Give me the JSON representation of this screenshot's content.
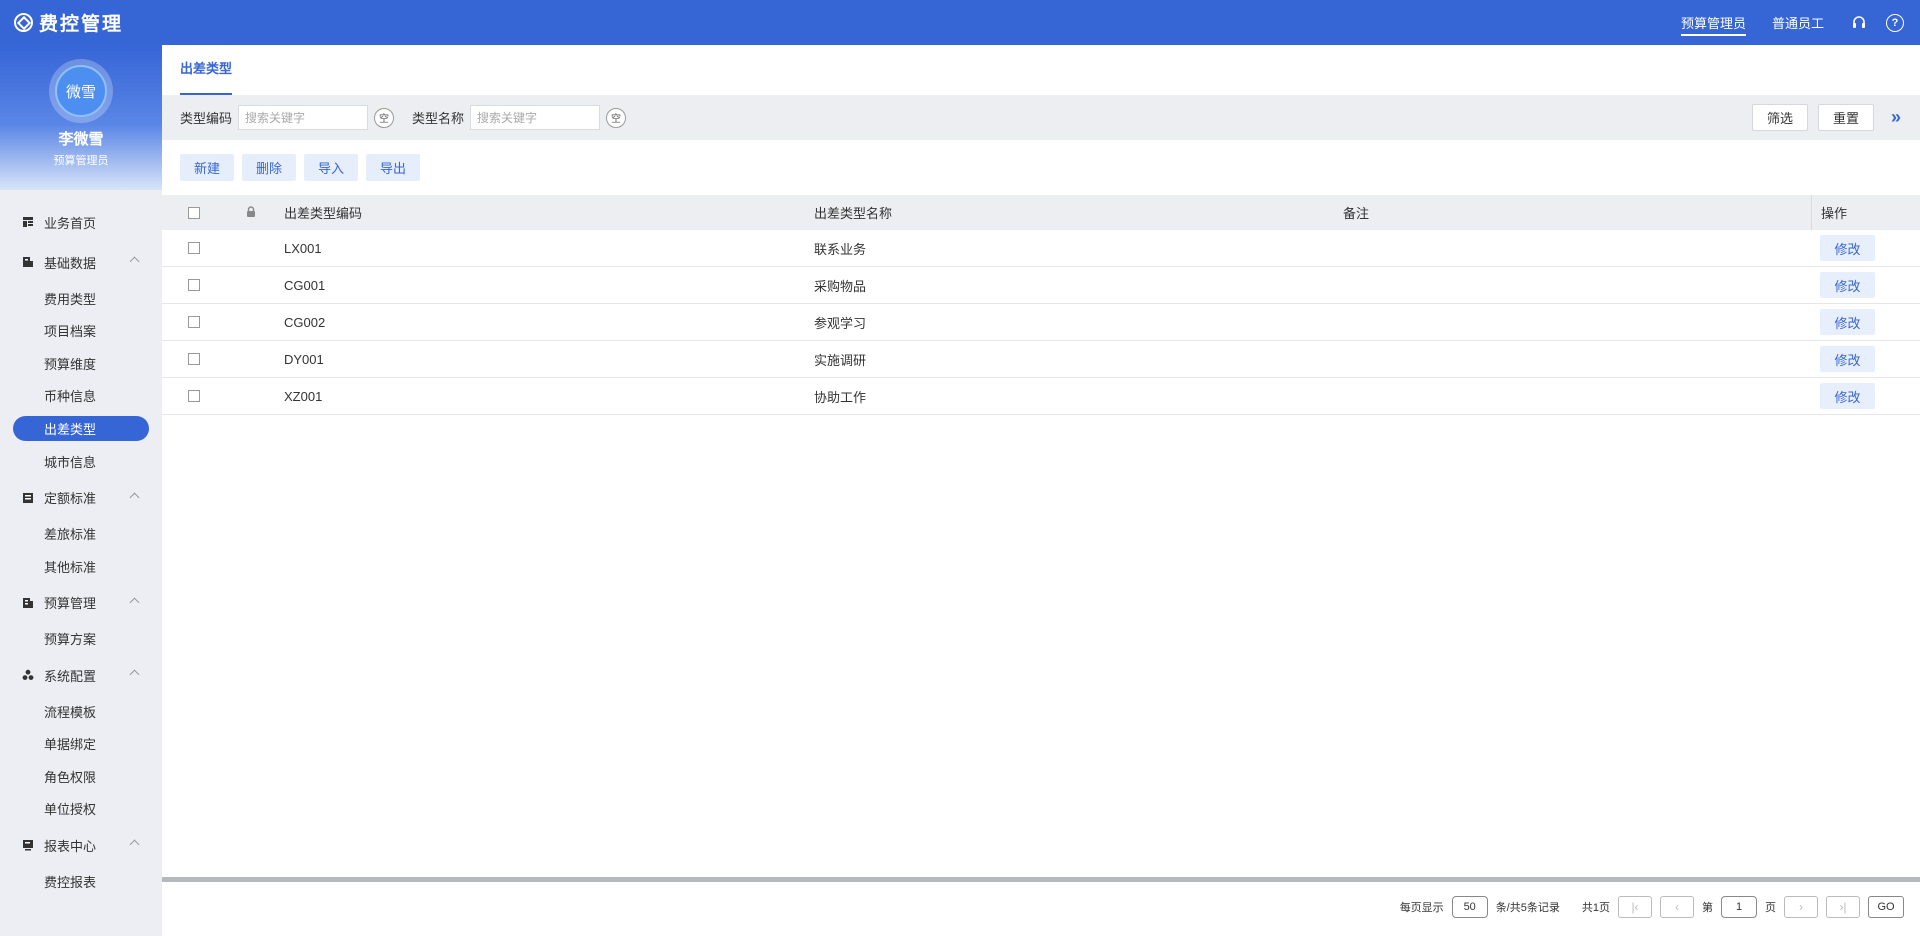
{
  "app": {
    "title": "费控管理"
  },
  "header": {
    "roles": [
      {
        "label": "预算管理员",
        "active": true
      },
      {
        "label": "普通员工",
        "active": false
      }
    ],
    "help_glyph": "?"
  },
  "profile": {
    "avatar_text": "微雪",
    "name": "李微雪",
    "role": "预算管理员"
  },
  "sidebar": {
    "home": "业务首页",
    "groups": [
      {
        "label": "基础数据",
        "icon": "database-icon",
        "items": [
          "费用类型",
          "项目档案",
          "预算维度",
          "币种信息",
          "出差类型",
          "城市信息"
        ]
      },
      {
        "label": "定额标准",
        "icon": "ledger-icon",
        "items": [
          "差旅标准",
          "其他标准"
        ]
      },
      {
        "label": "预算管理",
        "icon": "budget-icon",
        "items": [
          "预算方案"
        ]
      },
      {
        "label": "系统配置",
        "icon": "cluster-icon",
        "items": [
          "流程模板",
          "单据绑定",
          "角色权限",
          "单位授权"
        ]
      },
      {
        "label": "报表中心",
        "icon": "report-icon",
        "items": [
          "费控报表"
        ]
      }
    ],
    "active_item": "出差类型"
  },
  "page": {
    "tab": "出差类型"
  },
  "filters": {
    "code_label": "类型编码",
    "code_placeholder": "搜索关键字",
    "name_label": "类型名称",
    "name_placeholder": "搜索关键字",
    "clear_label": "空",
    "filter_button": "筛选",
    "reset_button": "重置",
    "expand_glyph": "»"
  },
  "toolbar": {
    "new": "新建",
    "delete": "删除",
    "import": "导入",
    "export": "导出"
  },
  "table": {
    "columns": {
      "code": "出差类型编码",
      "name": "出差类型名称",
      "remark": "备注",
      "op": "操作"
    },
    "rows": [
      {
        "code": "LX001",
        "name": "联系业务",
        "remark": "",
        "op": "修改"
      },
      {
        "code": "CG001",
        "name": "采购物品",
        "remark": "",
        "op": "修改"
      },
      {
        "code": "CG002",
        "name": "参观学习",
        "remark": "",
        "op": "修改"
      },
      {
        "code": "DY001",
        "name": "实施调研",
        "remark": "",
        "op": "修改"
      },
      {
        "code": "XZ001",
        "name": "协助工作",
        "remark": "",
        "op": "修改"
      }
    ]
  },
  "pager": {
    "per_page_label": "每页显示",
    "per_page": "50",
    "records_label": "条/共5条记录",
    "total_pages": "共1页",
    "page_prefix": "第",
    "page": "1",
    "page_suffix": "页",
    "go": "GO",
    "first_glyph": "|‹",
    "prev_glyph": "‹",
    "next_glyph": "›",
    "last_glyph": "›|"
  },
  "colors": {
    "primary": "#3665d6",
    "sidebar_bg": "#eceef4",
    "filter_bg": "#eceef1",
    "light_button": "#e6eefc"
  }
}
